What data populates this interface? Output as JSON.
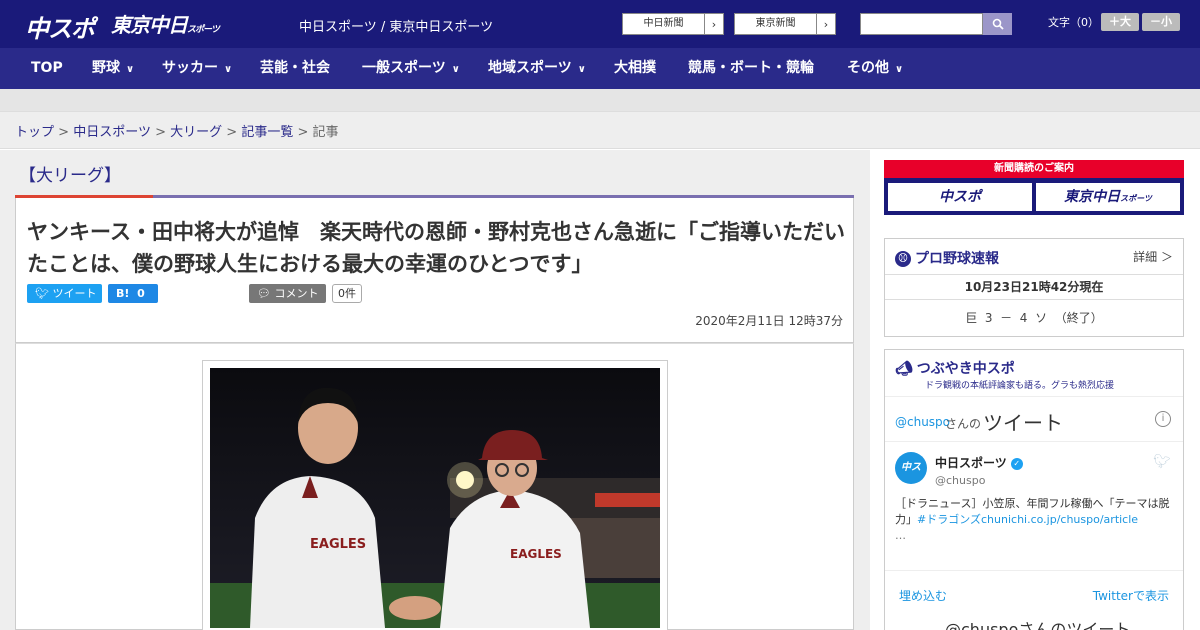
{
  "header": {
    "logo_main": "中スポ",
    "logo_tokyo": "東京中日",
    "logo_tokyo_sub": "スポーツ",
    "site_name": "中日スポーツ / 東京中日スポーツ",
    "paper_buttons": [
      {
        "label": "中日新聞"
      },
      {
        "label": "東京新聞"
      }
    ],
    "font_size_label": "文字（0）",
    "font_up": "＋大",
    "font_down": "－小"
  },
  "nav": {
    "items": [
      {
        "label": "TOP"
      },
      {
        "label": "野球"
      },
      {
        "label": "サッカー"
      },
      {
        "label": "芸能・社会"
      },
      {
        "label": "一般スポーツ"
      },
      {
        "label": "地域スポーツ"
      },
      {
        "label": "大相撲"
      },
      {
        "label": "競馬・ボート・競輪"
      },
      {
        "label": "その他"
      }
    ]
  },
  "breadcrumb": {
    "items": [
      "トップ",
      "中日スポーツ",
      "大リーグ",
      "記事一覧"
    ],
    "current": "記事",
    "separator": ">"
  },
  "article": {
    "category": "【大リーグ】",
    "title": "ヤンキース・田中将大が追悼　楽天時代の恩師・野村克也さん急逝に「ご指導いただいたことは、僕の野球人生における最大の幸運のひとつです」",
    "tweet_label": "ツイート",
    "hatena_label": "B!",
    "hatena_count": "0",
    "comment_label": "コメント",
    "comment_count": "0件",
    "date": "2020年2月11日 12時37分"
  },
  "sidebar": {
    "subscribe": {
      "heading": "新聞購読のご案内",
      "left": "中スポ",
      "right": "東京中日",
      "right_sub": "スポーツ"
    },
    "baseball": {
      "title": "プロ野球速報",
      "detail": "詳細 ＞",
      "time": "10月23日21時42分現在",
      "score": "巨  3  －  4  ソ  （終了）"
    },
    "tweets": {
      "title": "つぶやき中スポ",
      "sub": "ドラ観戦の本紙評論家も語る。グラも熱烈応援",
      "handle_prefix": "@chuspo",
      "handle_suffix": "さんの",
      "handle_big": "ツイート",
      "user_name": "中日スポーツ",
      "user_handle": "@chuspo",
      "tweet_text": "［ドラニュース］小笠原、年間フル稼働へ「テーマは脱力」",
      "tweet_link": "#ドラゴンズchunichi.co.jp/chuspo/article",
      "ellipsis": "…",
      "embed": "埋め込む",
      "view_on": "Twitterで表示",
      "footer": "@chuspoさんのツイート"
    }
  },
  "colors": {
    "header_bg": "#1a1a7a",
    "nav_bg": "#2a2a8a",
    "accent_red": "#d43"
  }
}
